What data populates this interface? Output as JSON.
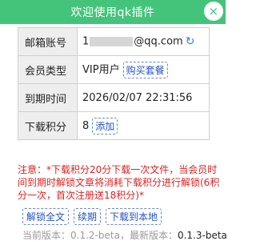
{
  "header": {
    "title": "欢迎使用qk插件",
    "close_label": "×"
  },
  "rows": {
    "email": {
      "label": "邮箱账号",
      "prefix": "1",
      "suffix": "@qq.com"
    },
    "membership": {
      "label": "会员类型",
      "value": "VIP用户",
      "button": "购买套餐"
    },
    "expiry": {
      "label": "到期时间",
      "value": "2026/02/07 22:31:56"
    },
    "points": {
      "label": "下载积分",
      "value": "8",
      "button": "添加"
    }
  },
  "notice": "注意：*下载积分20分下载一次文件，当会员时间到期时解锁文章将消耗下载积分进行解锁(6积分一次，首次注册送18积分)*",
  "actions": {
    "unlock": "解锁全文",
    "renew": "续期",
    "download": "下载到本地"
  },
  "versions": {
    "current_label": "当前版本：",
    "current": "0.1.2-beta",
    "separator": "，",
    "latest_label": "最新版本：",
    "latest": "0.1.3-beta"
  },
  "icons": {
    "refresh": "refresh-icon",
    "close": "close-icon"
  },
  "colors": {
    "header": "#43c47a",
    "notice": "#e02020",
    "link": "#2452c7"
  }
}
